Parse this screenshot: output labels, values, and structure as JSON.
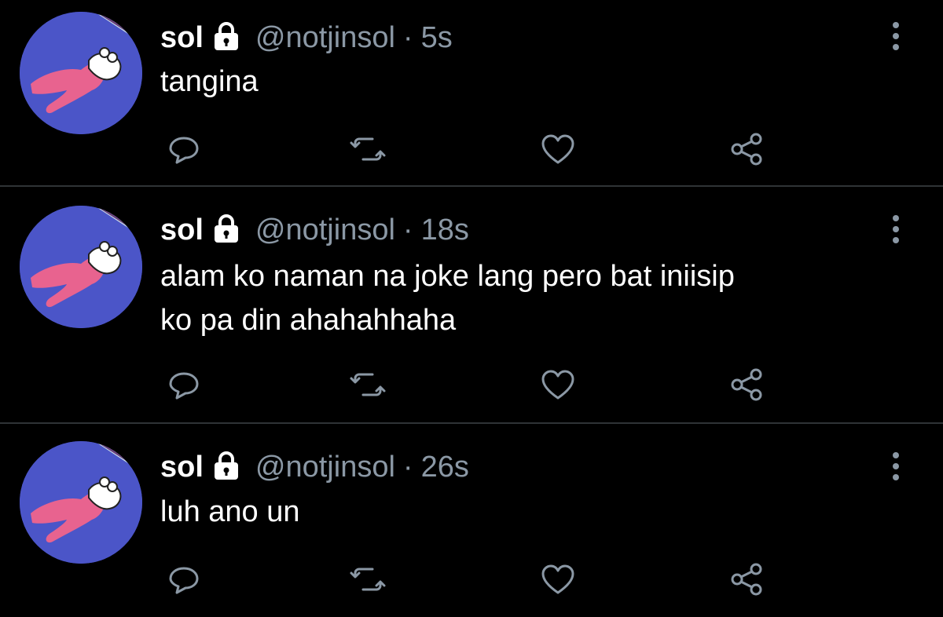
{
  "colors": {
    "background": "#000000",
    "text": "#ffffff",
    "muted": "#8b98a5",
    "divider": "#2f3336"
  },
  "tweets": [
    {
      "name": "sol",
      "handle": "@notjinsol",
      "separator": "·",
      "time": "5s",
      "text_lines": [
        "tangina"
      ]
    },
    {
      "name": "sol",
      "handle": "@notjinsol",
      "separator": "·",
      "time": "18s",
      "text_lines": [
        "alam ko naman na joke lang pero bat iniisip",
        "ko pa din ahahahhaha"
      ]
    },
    {
      "name": "sol",
      "handle": "@notjinsol",
      "separator": "·",
      "time": "26s",
      "text_lines": [
        "luh ano un"
      ]
    }
  ],
  "icons": {
    "verified_lock": "lock-icon",
    "reply": "reply-icon",
    "retweet": "retweet-icon",
    "like": "heart-icon",
    "share": "share-icon",
    "more": "more-vertical-icon"
  }
}
